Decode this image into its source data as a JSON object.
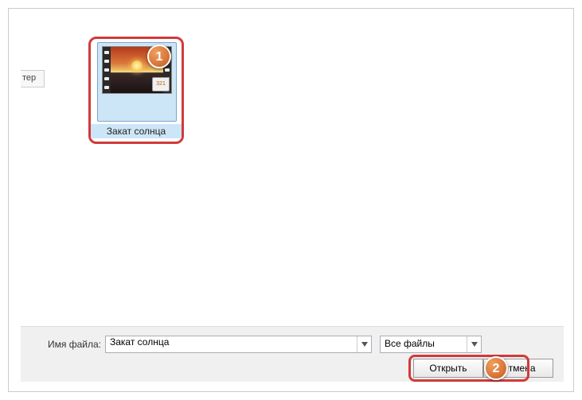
{
  "sidebar": {
    "truncated_item": "тер"
  },
  "file": {
    "name": "Закат солнца",
    "badge": "321"
  },
  "callouts": {
    "one": "1",
    "two": "2"
  },
  "bottom": {
    "filename_label": "Имя файла:",
    "filename_value": "Закат солнца",
    "filetype_value": "Все файлы",
    "open_label": "Открыть",
    "cancel_label": "Отмена"
  }
}
